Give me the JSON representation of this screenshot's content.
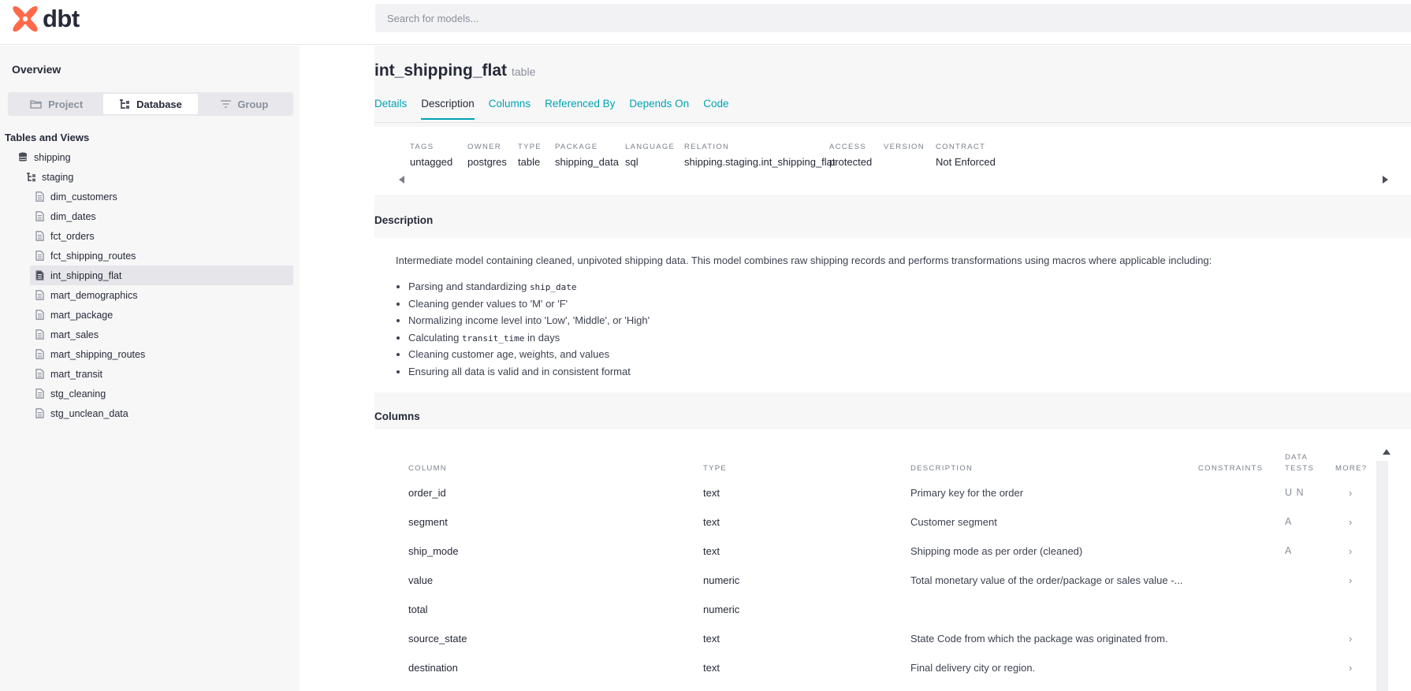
{
  "app": {
    "brand": "dbt",
    "search_placeholder": "Search for models..."
  },
  "sidebar": {
    "overview": "Overview",
    "view_tabs": [
      {
        "label": "Project",
        "icon": "folder-icon",
        "active": false
      },
      {
        "label": "Database",
        "icon": "tree-icon",
        "active": true
      },
      {
        "label": "Group",
        "icon": "filter-icon",
        "active": false
      }
    ],
    "section_title": "Tables and Views",
    "database": "shipping",
    "schema": "staging",
    "models": [
      "dim_customers",
      "dim_dates",
      "fct_orders",
      "fct_shipping_routes",
      "int_shipping_flat",
      "mart_demographics",
      "mart_package",
      "mart_sales",
      "mart_shipping_routes",
      "mart_transit",
      "stg_cleaning",
      "stg_unclean_data"
    ],
    "selected_model": "int_shipping_flat"
  },
  "model": {
    "name": "int_shipping_flat",
    "kind": "table",
    "tabs": [
      "Details",
      "Description",
      "Columns",
      "Referenced By",
      "Depends On",
      "Code"
    ],
    "active_tab": "Description",
    "meta": [
      {
        "key": "TAGS",
        "value": "untagged"
      },
      {
        "key": "OWNER",
        "value": "postgres"
      },
      {
        "key": "TYPE",
        "value": "table"
      },
      {
        "key": "PACKAGE",
        "value": "shipping_data"
      },
      {
        "key": "LANGUAGE",
        "value": "sql"
      },
      {
        "key": "RELATION",
        "value": "shipping.staging.int_shipping_flat"
      },
      {
        "key": "ACCESS",
        "value": "protected"
      },
      {
        "key": "VERSION",
        "value": ""
      },
      {
        "key": "CONTRACT",
        "value": "Not Enforced"
      }
    ]
  },
  "description": {
    "title": "Description",
    "intro": "Intermediate model containing cleaned, unpivoted shipping data. This model combines raw shipping records and performs transformations using macros where applicable including:",
    "bullets": [
      {
        "before": "Parsing and standardizing ",
        "code": "ship_date",
        "after": ""
      },
      {
        "before": "Cleaning gender values to 'M' or 'F'",
        "code": "",
        "after": ""
      },
      {
        "before": "Normalizing income level into 'Low', 'Middle', or 'High'",
        "code": "",
        "after": ""
      },
      {
        "before": "Calculating ",
        "code": "transit_time",
        "after": " in days"
      },
      {
        "before": "Cleaning customer age, weights, and values",
        "code": "",
        "after": ""
      },
      {
        "before": "Ensuring all data is valid and in consistent format",
        "code": "",
        "after": ""
      }
    ]
  },
  "columns": {
    "title": "Columns",
    "headers": {
      "column": "COLUMN",
      "type": "TYPE",
      "description": "DESCRIPTION",
      "constraints": "CONSTRAINTS",
      "data_tests_1": "DATA",
      "data_tests_2": "TESTS",
      "more": "MORE?"
    },
    "rows": [
      {
        "name": "order_id",
        "type": "text",
        "description": "Primary key for the order",
        "constraints": "",
        "tests": "U N",
        "more": "›"
      },
      {
        "name": "segment",
        "type": "text",
        "description": "Customer segment",
        "constraints": "",
        "tests": "A",
        "more": "›"
      },
      {
        "name": "ship_mode",
        "type": "text",
        "description": "Shipping mode as per order (cleaned)",
        "constraints": "",
        "tests": "A",
        "more": "›"
      },
      {
        "name": "value",
        "type": "numeric",
        "description": "Total monetary value of the order/package or sales value -...",
        "constraints": "",
        "tests": "",
        "more": "›"
      },
      {
        "name": "total",
        "type": "numeric",
        "description": "",
        "constraints": "",
        "tests": "",
        "more": ""
      },
      {
        "name": "source_state",
        "type": "text",
        "description": "State Code from which the package was originated from.",
        "constraints": "",
        "tests": "",
        "more": "›"
      },
      {
        "name": "destination",
        "type": "text",
        "description": "Final delivery city or region.",
        "constraints": "",
        "tests": "",
        "more": "›"
      }
    ]
  },
  "colors": {
    "brand": "#ff694a",
    "accent": "#00a3b4",
    "text": "#262a38",
    "muted": "#8a8f99"
  }
}
